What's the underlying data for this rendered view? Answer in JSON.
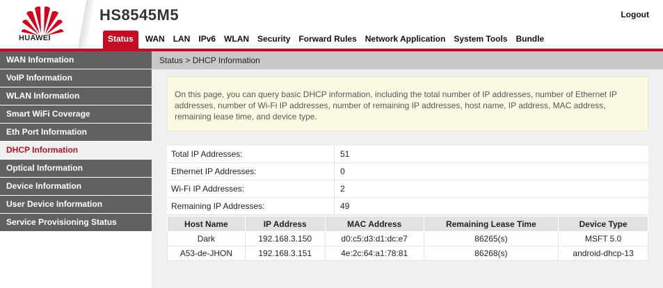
{
  "header": {
    "brand": "HUAWEI",
    "model": "HS8545M5",
    "logout_label": "Logout",
    "brand_color": "#c30d23"
  },
  "nav": {
    "tabs": [
      {
        "label": "Status",
        "active": true
      },
      {
        "label": "WAN"
      },
      {
        "label": "LAN"
      },
      {
        "label": "IPv6"
      },
      {
        "label": "WLAN"
      },
      {
        "label": "Security"
      },
      {
        "label": "Forward Rules"
      },
      {
        "label": "Network Application"
      },
      {
        "label": "System Tools"
      },
      {
        "label": "Bundle"
      }
    ]
  },
  "sidebar": {
    "items": [
      {
        "label": "WAN Information"
      },
      {
        "label": "VoIP Information"
      },
      {
        "label": "WLAN Information"
      },
      {
        "label": "Smart WiFi Coverage"
      },
      {
        "label": "Eth Port Information"
      },
      {
        "label": "DHCP Information",
        "active": true
      },
      {
        "label": "Optical Information"
      },
      {
        "label": "Device Information"
      },
      {
        "label": "User Device Information"
      },
      {
        "label": "Service Provisioning Status"
      }
    ]
  },
  "main": {
    "breadcrumb": "Status > DHCP Information",
    "description": "On this page, you can query basic DHCP information, including the total number of IP addresses, number of Ethernet IP addresses, number of Wi-Fi IP addresses, number of remaining IP addresses, host name, IP address, MAC address, remaining lease time, and device type.",
    "summary": [
      {
        "label": "Total IP Addresses:",
        "value": "51"
      },
      {
        "label": "Ethernet IP Addresses:",
        "value": "0"
      },
      {
        "label": "Wi-Fi IP Addresses:",
        "value": "2"
      },
      {
        "label": "Remaining IP Addresses:",
        "value": "49"
      }
    ],
    "table": {
      "headers": [
        "Host Name",
        "IP Address",
        "MAC Address",
        "Remaining Lease Time",
        "Device Type"
      ],
      "rows": [
        [
          "Dark",
          "192.168.3.150",
          "d0:c5:d3:d1:dc:e7",
          "86265(s)",
          "MSFT 5.0"
        ],
        [
          "A53-de-JHON",
          "192.168.3.151",
          "4e:2c:64:a1:78:81",
          "86268(s)",
          "android-dhcp-13"
        ]
      ]
    }
  }
}
